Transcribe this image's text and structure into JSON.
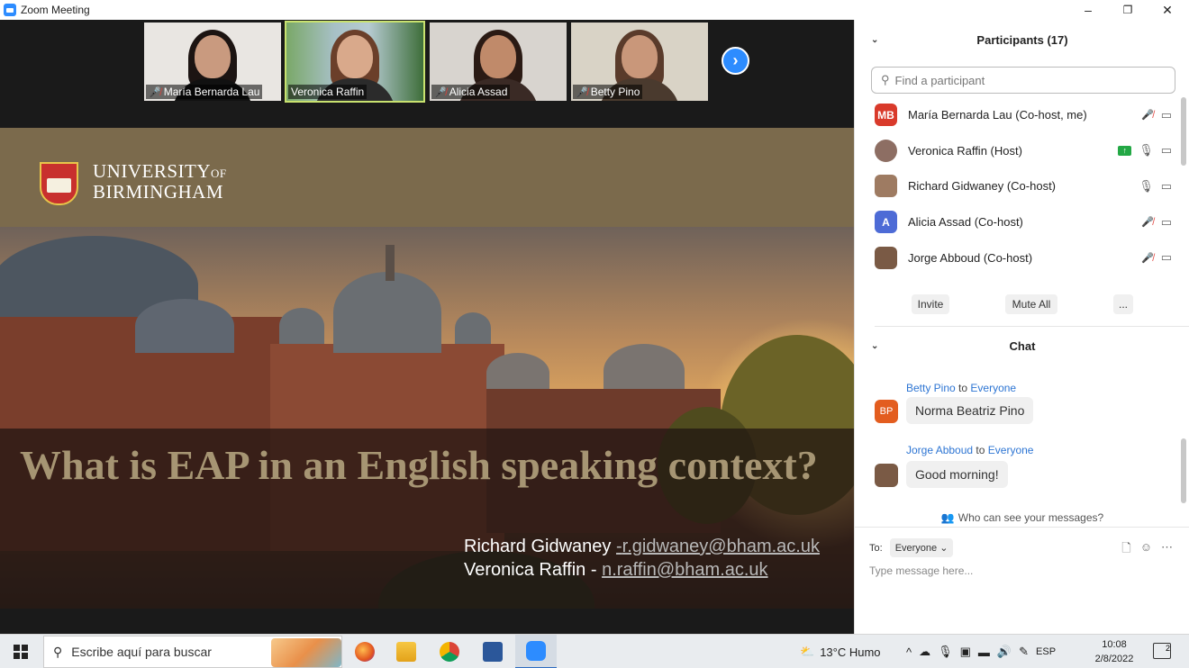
{
  "window": {
    "title": "Zoom Meeting",
    "minimize": "–",
    "maximize": "❐",
    "close": "✕"
  },
  "thumbnails": [
    {
      "name": "María Bernarda Lau",
      "muted": true
    },
    {
      "name": "Veronica Raffin",
      "muted": false,
      "active_speaker": true
    },
    {
      "name": "Alicia Assad",
      "muted": true
    },
    {
      "name": "Betty Pino",
      "muted": true
    }
  ],
  "thumb_next_icon": "chevron-right-icon",
  "slide": {
    "logo_line1": "UNIVERSITY",
    "logo_of": "OF",
    "logo_line2": "BIRMINGHAM",
    "title": "What is EAP in an English speaking context?",
    "presenter1_name": "Richard Gidwaney",
    "presenter1_email": "r.gidwaney@bham.ac.uk",
    "presenter2_name": "Veronica Raffin",
    "presenter2_email": "n.raffin@bham.ac.uk",
    "dash": "-"
  },
  "participants": {
    "header": "Participants (17)",
    "search_placeholder": "Find a participant",
    "list": [
      {
        "initials": "MB",
        "name": "María Bernarda Lau (Co-host, me)",
        "color": "#d93a2b",
        "mic": "muted",
        "video": "off"
      },
      {
        "initials": "",
        "name": "Veronica Raffin (Host)",
        "color": "#8d6e63",
        "mic": "on",
        "video": "off",
        "sharing": true
      },
      {
        "initials": "",
        "name": "Richard Gidwaney (Co-host)",
        "color": "#9e7b62",
        "mic": "on",
        "video": "off"
      },
      {
        "initials": "A",
        "name": "Alicia Assad (Co-host)",
        "color": "#4d6bd6",
        "mic": "muted",
        "video": "off"
      },
      {
        "initials": "",
        "name": "Jorge Abboud (Co-host)",
        "color": "#7a5a45",
        "mic": "muted",
        "video": "off"
      }
    ],
    "invite": "Invite",
    "mute_all": "Mute All",
    "more": "..."
  },
  "chat": {
    "header": "Chat",
    "to_word": "to",
    "messages": [
      {
        "from": "Betty Pino",
        "to": "Everyone",
        "initials": "BP",
        "avatar_color": "#e35d1f",
        "text": "Norma Beatriz Pino"
      },
      {
        "from": "Jorge Abboud",
        "to": "Everyone",
        "initials": "",
        "avatar_color": "#7a5a45",
        "text": "Good morning!"
      }
    ],
    "who_can_see": "Who can see your messages?",
    "to_label": "To:",
    "to_value": "Everyone",
    "placeholder": "Type message here..."
  },
  "taskbar": {
    "search_text": "Escribe aquí para buscar",
    "weather": "13°C  Humo",
    "lang": "ESP",
    "time": "10:08",
    "date": "2/8/2022",
    "notifications": "2"
  },
  "colors": {
    "zoom_blue": "#2d8cff",
    "slide_gold": "#a69573",
    "chat_link": "#2d75d3"
  }
}
